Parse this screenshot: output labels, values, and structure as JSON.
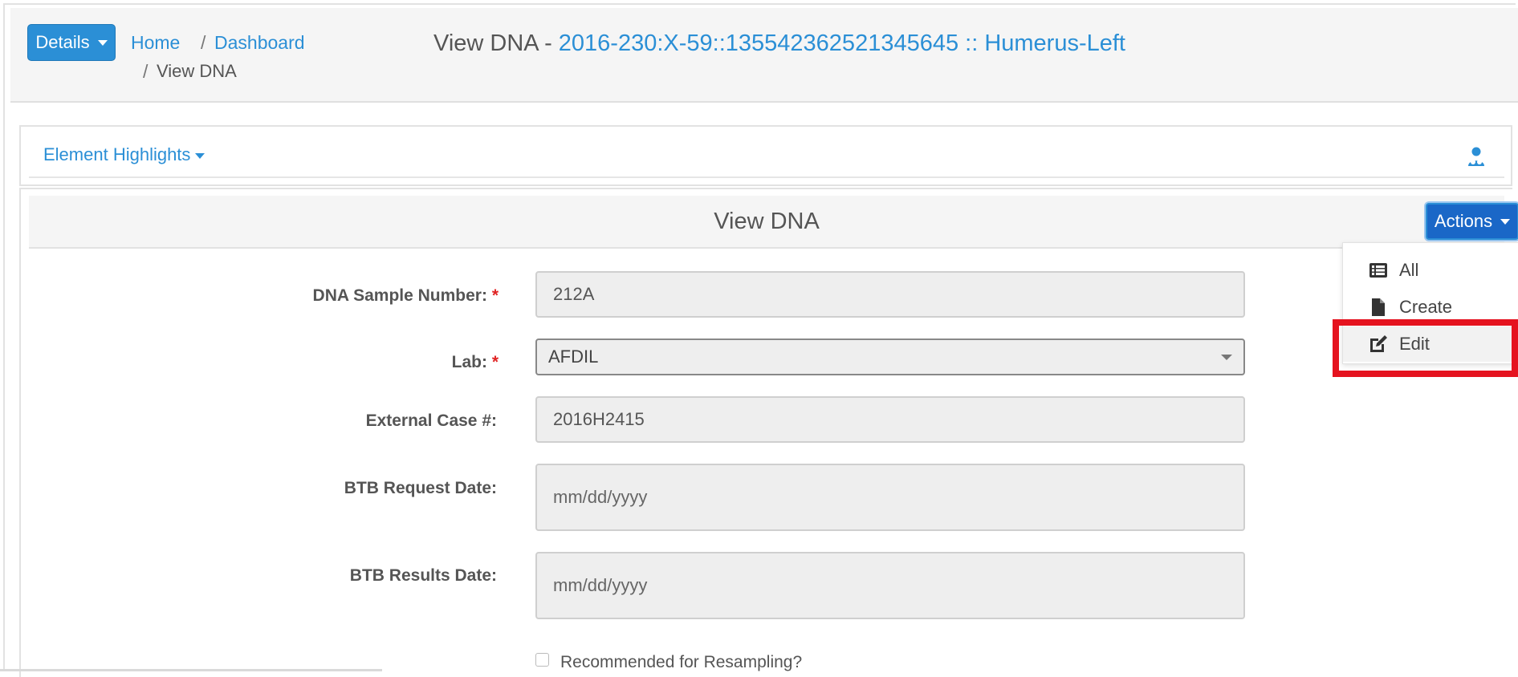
{
  "header": {
    "details_label": "Details",
    "breadcrumb": {
      "home": "Home",
      "sep1": "/",
      "dashboard": "Dashboard",
      "sep2": "/",
      "current": "View DNA"
    },
    "title_prefix": "View DNA - ",
    "title_link": "2016-230:X-59::135542362521345645 :: Humerus-Left"
  },
  "highlights": {
    "label": "Element Highlights"
  },
  "panel": {
    "title": "View DNA",
    "actions_label": "Actions"
  },
  "actions_menu": {
    "items": [
      {
        "label": "All",
        "icon": "list-icon"
      },
      {
        "label": "Create",
        "icon": "file-icon"
      },
      {
        "label": "Edit",
        "icon": "edit-icon"
      }
    ]
  },
  "form": {
    "dna_sample_number": {
      "label": "DNA Sample Number:",
      "required": "*",
      "value": "212A"
    },
    "lab": {
      "label": "Lab:",
      "required": "*",
      "value": "AFDIL"
    },
    "external_case": {
      "label": "External Case #:",
      "value": "2016H2415"
    },
    "btb_request_date": {
      "label": "BTB Request Date:",
      "placeholder": "mm/dd/yyyy"
    },
    "btb_results_date": {
      "label": "BTB Results Date:",
      "placeholder": "mm/dd/yyyy"
    },
    "resampling": {
      "label": "Recommended for Resampling?"
    }
  },
  "colors": {
    "primary": "#2b8fd6",
    "actions": "#1a67c7",
    "highlight": "#e5131f"
  }
}
